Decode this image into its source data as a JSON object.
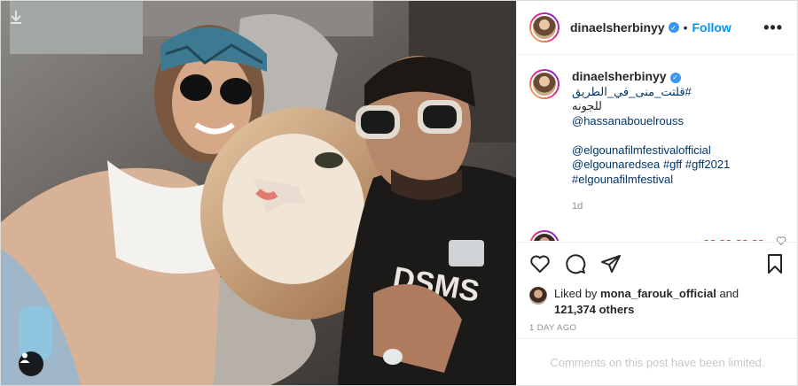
{
  "post": {
    "username": "dinaelsherbinyy",
    "follow_label": "Follow",
    "more_label": "•••",
    "caption": {
      "username": "dinaelsherbinyy",
      "hashtag_ar_1": "#قلتت_منى_في_الطريق",
      "hashtag_ar_2": "للجونه",
      "mention_1": "@hassanabouelrouss",
      "mention_2": "@elgounafilmfestivalofficial",
      "mention_3": "@elgounaredsea",
      "tags_line": "#gff #gff2021",
      "tag_last": "#elgounafilmfestival",
      "time": "1d"
    },
    "comment2": {
      "username": "naglaabadr_official",
      "text": "❤️❤️❤️❤️"
    },
    "likes": {
      "prefix": "Liked by",
      "user": "mona_farouk_official",
      "and": "and",
      "count": "121,374 others"
    },
    "timestamp": "1 DAY AGO",
    "comments_limited": "Comments on this post have been limited."
  },
  "icons": [
    "download-icon",
    "tag-user-icon",
    "verified-icon",
    "heart-icon",
    "comment-icon",
    "share-icon",
    "bookmark-icon"
  ],
  "colors": {
    "link": "#00376b",
    "follow": "#0095f6",
    "verified": "#3897f0",
    "heart": "#ed0e3a"
  }
}
